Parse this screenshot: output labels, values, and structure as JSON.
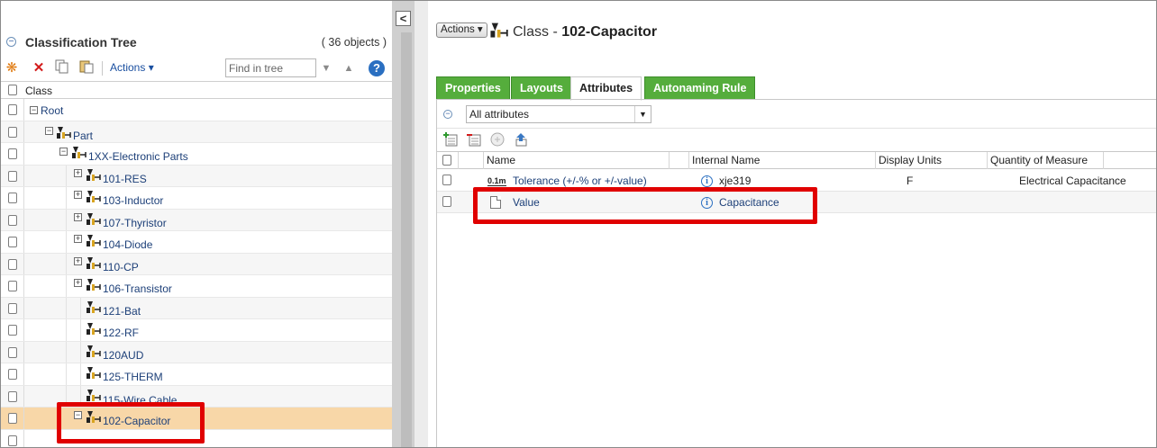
{
  "left_panel": {
    "title": "Classification Tree",
    "count": "( 36 objects )",
    "toolbar": {
      "actions_label": "Actions",
      "find_placeholder": "Find in tree",
      "help": "?"
    },
    "column_header": "Class",
    "tree": [
      {
        "label": "Root",
        "expander": "−"
      },
      {
        "label": "Part",
        "expander": "−"
      },
      {
        "label": "1XX-Electronic Parts",
        "expander": "−"
      },
      {
        "label": "101-RES",
        "expander": "+"
      },
      {
        "label": "103-Inductor",
        "expander": "+"
      },
      {
        "label": "107-Thyristor",
        "expander": "+"
      },
      {
        "label": "104-Diode",
        "expander": "+"
      },
      {
        "label": "110-CP",
        "expander": "+"
      },
      {
        "label": "106-Transistor",
        "expander": "+"
      },
      {
        "label": "121-Bat",
        "expander": ""
      },
      {
        "label": "122-RF",
        "expander": ""
      },
      {
        "label": "120AUD",
        "expander": ""
      },
      {
        "label": "125-THERM",
        "expander": ""
      },
      {
        "label": "115-Wire Cable",
        "expander": ""
      },
      {
        "label": "102-Capacitor",
        "expander": "−"
      }
    ],
    "collapse_button": "<"
  },
  "right_panel": {
    "actions_label": "Actions",
    "title_prefix": "Class - ",
    "title_name": "102-Capacitor",
    "tabs": [
      {
        "label": "Properties",
        "active": false
      },
      {
        "label": "Layouts",
        "active": false
      },
      {
        "label": "Attributes",
        "active": true
      },
      {
        "label": "Autonaming Rule",
        "active": false
      }
    ],
    "filter": {
      "selected": "All attributes"
    },
    "grid": {
      "columns": [
        "Name",
        "Internal Name",
        "Display Units",
        "Quantity of Measure"
      ],
      "rows": [
        {
          "icon": "0.1m",
          "name": "Tolerance (+/-% or +/-value)",
          "internal_name": "xje319",
          "display_units": "F",
          "quantity": "Electrical Capacitance"
        },
        {
          "icon": "doc-icon",
          "name": "Value",
          "internal_name": "Capacitance",
          "display_units": "",
          "quantity": ""
        }
      ]
    }
  },
  "colors": {
    "tab_green": "#55ad3c",
    "selected_row": "#f8d7a8",
    "highlight_red": "#e00000",
    "link_blue": "#1c3f78"
  }
}
